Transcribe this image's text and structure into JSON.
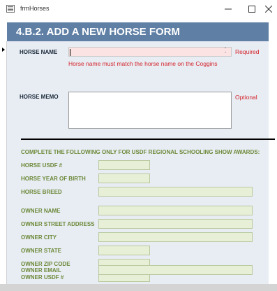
{
  "window": {
    "title": "frmHorses",
    "min_icon": "minimize-icon",
    "max_icon": "maximize-icon",
    "close_icon": "close-icon"
  },
  "form": {
    "heading": "4.B.2. ADD A NEW HORSE FORM",
    "horse_name_label": "HORSE NAME",
    "horse_name_value": "",
    "horse_name_required": "Required",
    "horse_name_hint": "Horse name must match the horse name on the Coggins",
    "horse_memo_label": "HORSE MEMO",
    "horse_memo_value": "",
    "horse_memo_optional": "Optional",
    "section_note": "COMPLETE THE FOLLOWING ONLY FOR USDF REGIONAL SCHOOLING SHOW AWARDS:",
    "fields": [
      {
        "label": "HORSE USDF #",
        "value": ""
      },
      {
        "label": "HORSE YEAR OF BIRTH",
        "value": ""
      },
      {
        "label": "HORSE BREED",
        "value": ""
      },
      {
        "label": "OWNER NAME",
        "value": ""
      },
      {
        "label": "OWNER STREET ADDRESS",
        "value": ""
      },
      {
        "label": "OWNER CITY",
        "value": ""
      },
      {
        "label": "OWNER STATE",
        "value": ""
      },
      {
        "label": "OWNER ZIP CODE",
        "value": ""
      },
      {
        "label": "OWNER USDF #",
        "value": ""
      },
      {
        "label": "OWNER EMAIL",
        "value": ""
      }
    ]
  },
  "colors": {
    "header_bg": "#5f7fa5",
    "detail_bg": "#e8ecf3",
    "required_text": "#d4242a",
    "section_label": "#6d8a3a",
    "field_bg": "#e7efd6",
    "name_field_bg": "#fbe3e3"
  }
}
